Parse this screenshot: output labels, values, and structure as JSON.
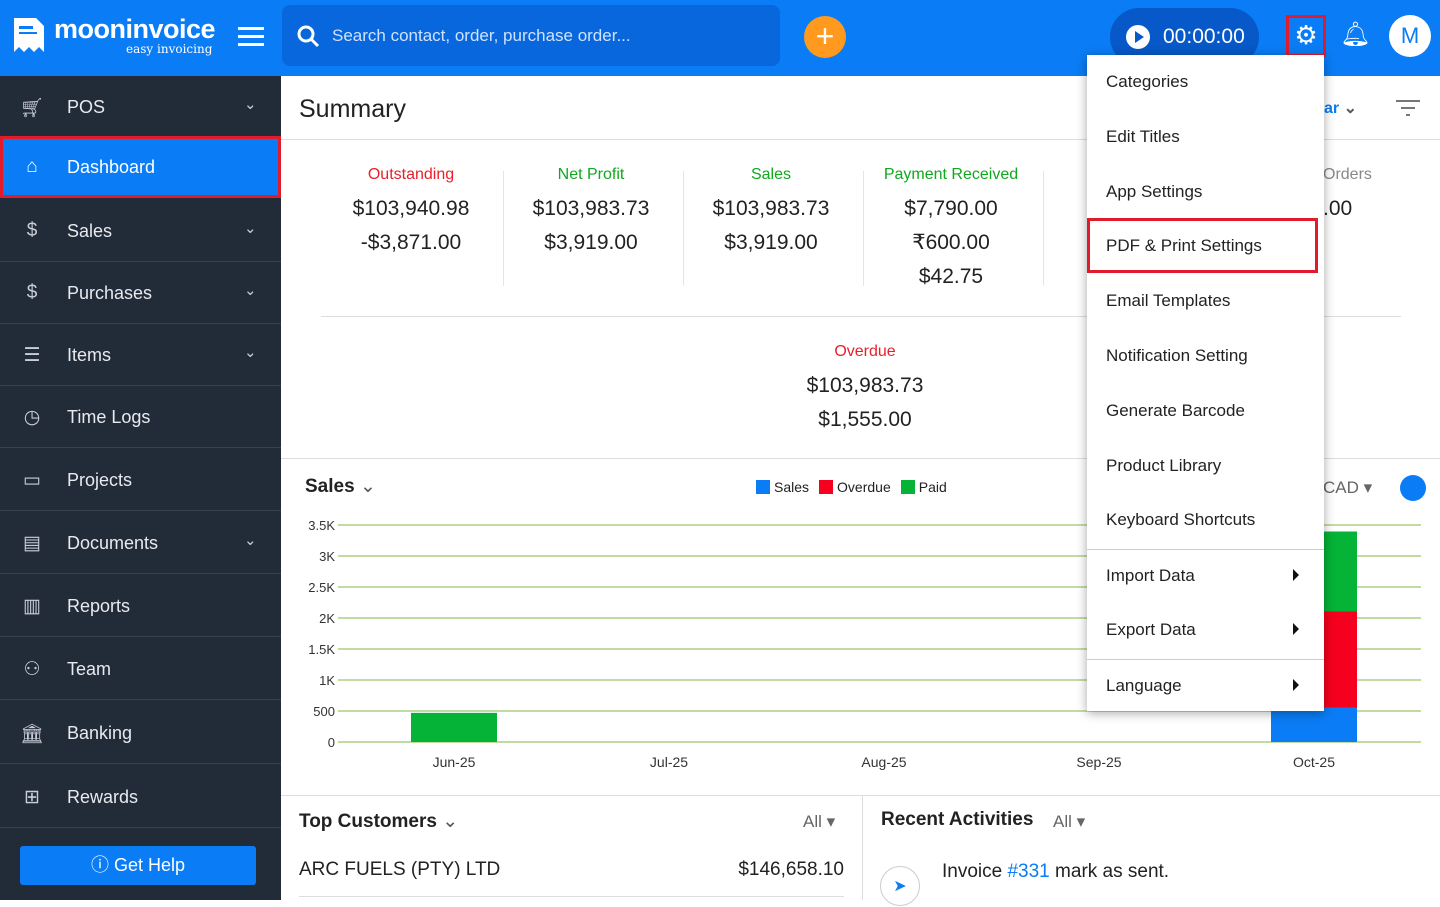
{
  "header": {
    "brand": "mooninvoice",
    "tagline": "easy invoicing",
    "search_placeholder": "Search contact, order, purchase order...",
    "add": "+",
    "timer": "00:00:00",
    "avatar": "M"
  },
  "sidebar": {
    "items": [
      {
        "label": "POS",
        "icon": "basket-icon",
        "chevron": true
      },
      {
        "label": "Dashboard",
        "icon": "home-icon",
        "chevron": false,
        "active": true
      },
      {
        "label": "Sales",
        "icon": "dollar-doc-icon",
        "chevron": true
      },
      {
        "label": "Purchases",
        "icon": "bag-icon",
        "chevron": true
      },
      {
        "label": "Items",
        "icon": "list-icon",
        "chevron": true
      },
      {
        "label": "Time Logs",
        "icon": "clock-icon",
        "chevron": false
      },
      {
        "label": "Projects",
        "icon": "folder-icon",
        "chevron": false
      },
      {
        "label": "Documents",
        "icon": "document-icon",
        "chevron": true
      },
      {
        "label": "Reports",
        "icon": "chart-icon",
        "chevron": false
      },
      {
        "label": "Team",
        "icon": "team-icon",
        "chevron": false
      },
      {
        "label": "Banking",
        "icon": "bank-icon",
        "chevron": false
      },
      {
        "label": "Rewards",
        "icon": "gift-icon",
        "chevron": false
      }
    ],
    "help": "Get Help"
  },
  "summary": {
    "title": "Summary",
    "period_partial": "ar",
    "stats": [
      {
        "title": "Outstanding",
        "color": "#e8202a",
        "values": [
          "$103,940.98",
          "-$3,871.00"
        ]
      },
      {
        "title": "Net Profit",
        "color": "#10a81e",
        "values": [
          "$103,983.73",
          "$3,919.00"
        ]
      },
      {
        "title": "Sales",
        "color": "#10a81e",
        "values": [
          "$103,983.73",
          "$3,919.00"
        ]
      },
      {
        "title": "Payment Received",
        "color": "#10a81e",
        "values": [
          "$7,790.00",
          "₹600.00",
          "$42.75"
        ]
      },
      {
        "title": "Orders",
        "color": "#888",
        "values": [
          ".00"
        ]
      },
      {
        "title": "Overdue",
        "color": "#e8202a",
        "values": [
          "$103,983.73",
          "$1,555.00"
        ]
      }
    ]
  },
  "sales_card": {
    "title": "Sales",
    "currency": "CAD"
  },
  "chart_data": {
    "type": "bar",
    "stacked": true,
    "categories": [
      "Jun-25",
      "Jul-25",
      "Aug-25",
      "Sep-25",
      "Oct-25"
    ],
    "series": [
      {
        "name": "Sales",
        "color": "#0a7cf5",
        "values": [
          0,
          0,
          0,
          0,
          550
        ]
      },
      {
        "name": "Overdue",
        "color": "#f5001e",
        "values": [
          0,
          0,
          0,
          0,
          1555
        ]
      },
      {
        "name": "Paid",
        "color": "#05b336",
        "values": [
          470,
          0,
          0,
          0,
          1290
        ]
      }
    ],
    "yticks": [
      "0",
      "500",
      "1K",
      "1.5K",
      "2K",
      "2.5K",
      "3K",
      "3.5K"
    ],
    "ylim": [
      0,
      3500
    ],
    "grid": true,
    "legend": "top"
  },
  "top_customers": {
    "title": "Top Customers",
    "filter": "All",
    "rows": [
      {
        "name": "ARC FUELS (PTY) LTD",
        "amount": "$146,658.10"
      }
    ]
  },
  "recent": {
    "title": "Recent Activities",
    "filter": "All",
    "item": {
      "pre": "Invoice ",
      "link": "#331",
      "post": " mark as sent."
    }
  },
  "settings_menu": {
    "items": [
      "Categories",
      "Edit Titles",
      "App Settings",
      "PDF & Print Settings",
      "Email Templates",
      "Notification Setting",
      "Generate Barcode",
      "Product Library",
      "Keyboard Shortcuts",
      "Import Data",
      "Export Data",
      "Language"
    ]
  }
}
